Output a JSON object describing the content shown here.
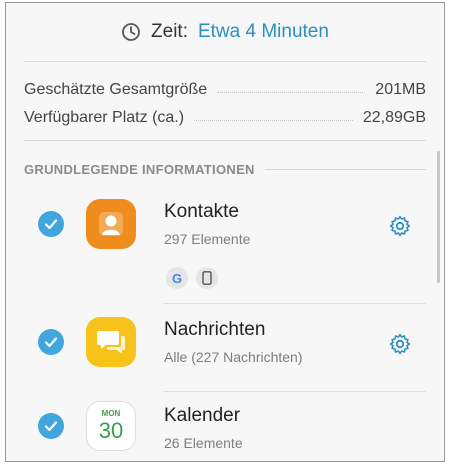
{
  "time": {
    "label": "Zeit:",
    "value": "Etwa 4 Minuten",
    "icon": "clock-icon"
  },
  "sizes": [
    {
      "label": "Geschätzte Gesamtgröße",
      "value": "201MB"
    },
    {
      "label": "Verfügbarer Platz (ca.)",
      "value": "22,89GB"
    }
  ],
  "section": {
    "title": "GRUNDLEGENDE INFORMATIONEN"
  },
  "items": [
    {
      "title": "Kontakte",
      "subtitle": "297 Elemente",
      "icon": "contacts-icon",
      "color": "#f08c1b",
      "checked": true,
      "settings": true,
      "sources": [
        "google-icon",
        "phone-icon"
      ]
    },
    {
      "title": "Nachrichten",
      "subtitle": "Alle (227 Nachrichten)",
      "icon": "messages-icon",
      "color": "#f7c31a",
      "checked": true,
      "settings": true
    },
    {
      "title": "Kalender",
      "subtitle": "26 Elemente",
      "icon": "calendar-icon",
      "checked": true,
      "calendar": {
        "month": "MON",
        "day": "30"
      }
    }
  ],
  "colors": {
    "accent": "#41a6de",
    "link": "#2b8fc1"
  }
}
